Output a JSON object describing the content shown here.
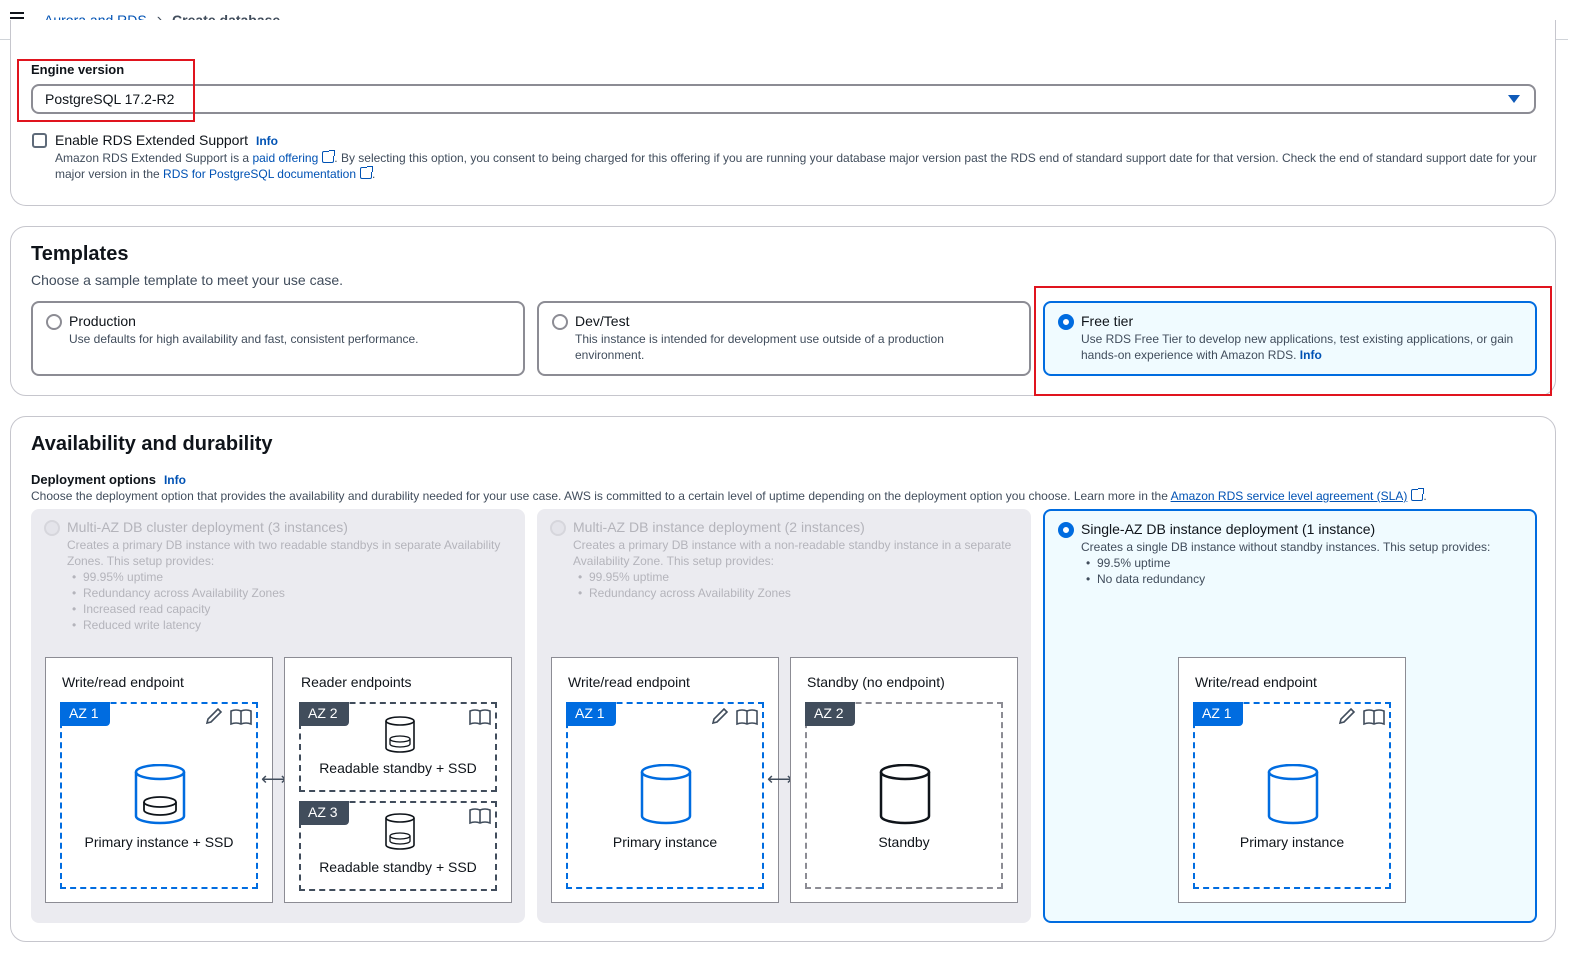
{
  "breadcrumb": {
    "parent": "Aurora and RDS",
    "current": "Create database"
  },
  "engine": {
    "label": "Engine version",
    "value": "PostgreSQL 17.2-R2",
    "extended_label": "Enable RDS Extended Support",
    "info": "Info",
    "desc_1": "Amazon RDS Extended Support is a ",
    "desc_link1": "paid offering",
    "desc_2": ". By selecting this option, you consent to being charged for this offering if you are running your database major version past the RDS end of standard support date for that version. Check the end of standard support date for your major version in the ",
    "desc_link2": "RDS for PostgreSQL documentation",
    "desc_3": "."
  },
  "templates": {
    "title": "Templates",
    "subtitle": "Choose a sample template to meet your use case.",
    "options": [
      {
        "title": "Production",
        "desc": "Use defaults for high availability and fast, consistent performance."
      },
      {
        "title": "Dev/Test",
        "desc": "This instance is intended for development use outside of a production environment."
      },
      {
        "title": "Free tier",
        "desc": "Use RDS Free Tier to develop new applications, test existing applications, or gain hands-on experience with Amazon RDS.",
        "info": "Info"
      }
    ]
  },
  "availability": {
    "title": "Availability and durability",
    "deploy_label": "Deployment options",
    "info": "Info",
    "desc": "Choose the deployment option that provides the availability and durability needed for your use case. AWS is committed to a certain level of uptime depending on the deployment option you choose. Learn more in the ",
    "link": "Amazon RDS service level agreement (SLA)",
    "desc_end": ".",
    "options": [
      {
        "title": "Multi-AZ DB cluster deployment (3 instances)",
        "desc": "Creates a primary DB instance with two readable standbys in separate Availability Zones. This setup provides:",
        "bullets": [
          "99.95% uptime",
          "Redundancy across Availability Zones",
          "Increased read capacity",
          "Reduced write latency"
        ]
      },
      {
        "title": "Multi-AZ DB instance deployment (2 instances)",
        "desc": "Creates a primary DB instance with a non-readable standby instance in a separate Availability Zone. This setup provides:",
        "bullets": [
          "99.95% uptime",
          "Redundancy across Availability Zones"
        ]
      },
      {
        "title": "Single-AZ DB instance deployment (1 instance)",
        "desc": "Creates a single DB instance without standby instances. This setup provides:",
        "bullets": [
          "99.5% uptime",
          "No data redundancy"
        ]
      }
    ],
    "diagram": {
      "write_read": "Write/read endpoint",
      "reader": "Reader endpoints",
      "standby_box": "Standby (no endpoint)",
      "az1": "AZ 1",
      "az2": "AZ 2",
      "az3": "AZ 3",
      "primary_ssd": "Primary instance + SSD",
      "readable": "Readable standby + SSD",
      "primary": "Primary instance",
      "standby": "Standby",
      "arrow": "⟷"
    }
  }
}
